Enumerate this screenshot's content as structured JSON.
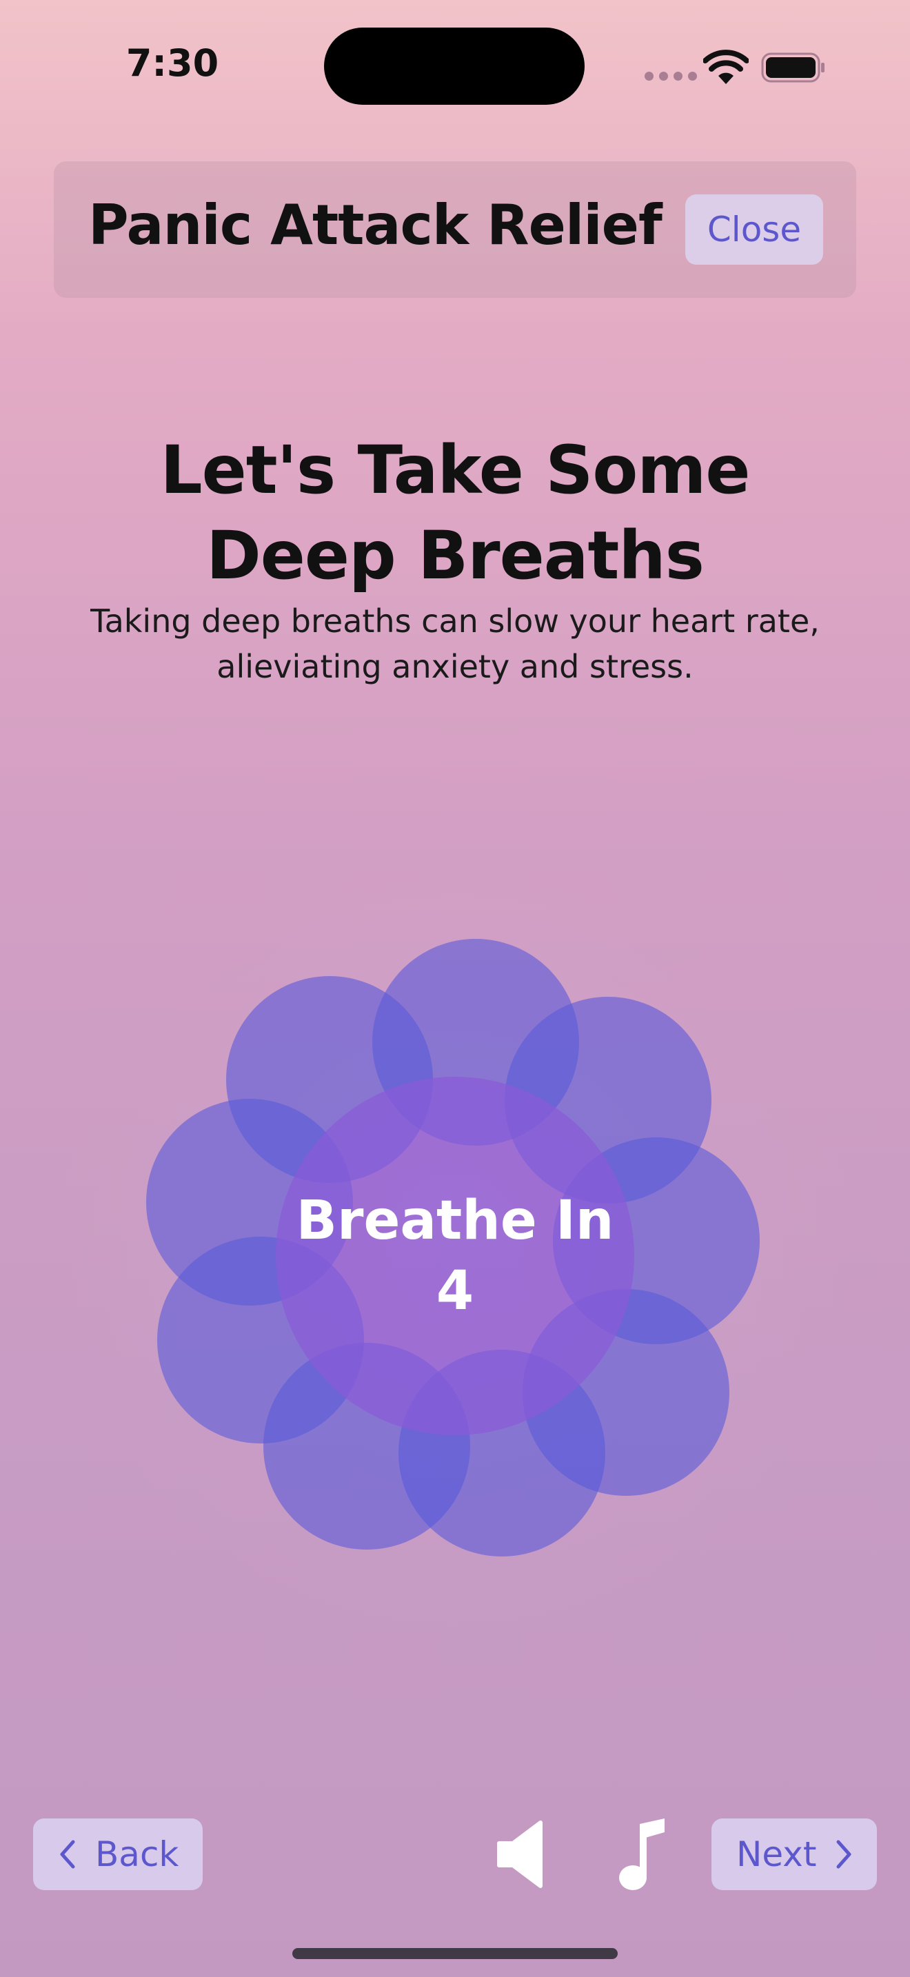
{
  "status_bar": {
    "time": "7:30",
    "icons": [
      "signal-dots-icon",
      "wifi-icon",
      "battery-icon"
    ]
  },
  "header": {
    "title": "Panic Attack Relief",
    "close_label": "Close"
  },
  "main": {
    "heading_line1": "Let's Take Some",
    "heading_line2": "Deep Breaths",
    "subtitle_line1": "Taking deep breaths can slow your heart rate,",
    "subtitle_line2": "alieviating anxiety and stress."
  },
  "breathing": {
    "instruction": "Breathe In",
    "count": "4"
  },
  "bottom_bar": {
    "back_label": "Back",
    "next_label": "Next",
    "icons": [
      "speaker-icon",
      "music-note-icon"
    ]
  },
  "colors": {
    "accent": "#5c57cc",
    "petal": "#5a5ad8",
    "center": "#8a5ad8",
    "button_bg": "#dcd7f5"
  }
}
